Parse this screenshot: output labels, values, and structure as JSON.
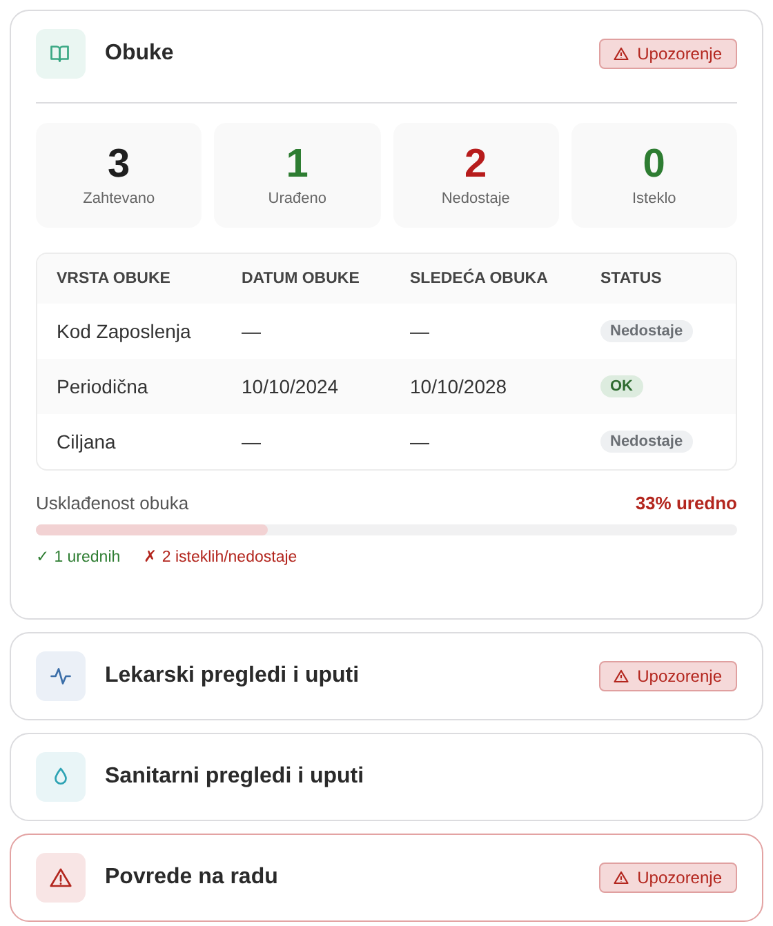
{
  "sections": [
    {
      "kind": "book",
      "title": "Obuke",
      "badge": "Upozorenje",
      "alert": false,
      "expanded": true,
      "stats": [
        {
          "value": "3",
          "label": "Zahtevano",
          "color": "#1f1f1f"
        },
        {
          "value": "1",
          "label": "Urađeno",
          "color": "#2e7d32"
        },
        {
          "value": "2",
          "label": "Nedostaje",
          "color": "#b71c1c"
        },
        {
          "value": "0",
          "label": "Isteklo",
          "color": "#2e7d32"
        }
      ],
      "table": {
        "columns": [
          "VRSTA OBUKE",
          "DATUM OBUKE",
          "SLEDEĆA OBUKA",
          "STATUS"
        ],
        "rows": [
          {
            "type": "Kod Zaposlenja",
            "date": "—",
            "next": "—",
            "status": "Nedostaje",
            "kind": "missing"
          },
          {
            "type": "Periodična",
            "date": "10/10/2024",
            "next": "10/10/2028",
            "status": "OK",
            "kind": "ok"
          },
          {
            "type": "Ciljana",
            "date": "—",
            "next": "—",
            "status": "Nedostaje",
            "kind": "missing"
          }
        ]
      },
      "compliance": {
        "label": "Usklađenost obuka",
        "reading": "33% uredno",
        "level": 0.33,
        "ok_text": "✓ 1 urednih",
        "bad_text": "✗ 2 isteklih/nedostaje"
      }
    },
    {
      "kind": "pulse",
      "title": "Lekarski pregledi i uputi",
      "badge": "Upozorenje",
      "alert": false,
      "expanded": false
    },
    {
      "kind": "drop",
      "title": "Sanitarni pregledi i uputi",
      "alert": false,
      "expanded": false
    },
    {
      "kind": "warning",
      "title": "Povrede na radu",
      "badge": "Upozorenje",
      "alert": true,
      "expanded": false
    }
  ]
}
